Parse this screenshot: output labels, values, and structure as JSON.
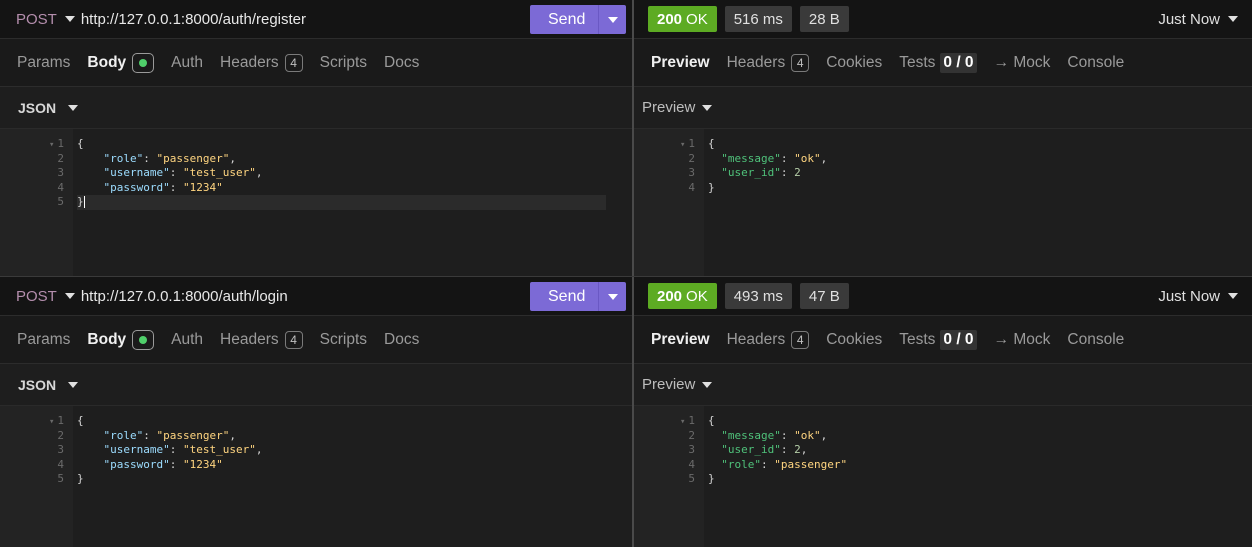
{
  "requests": [
    {
      "method": "POST",
      "url": "http://127.0.0.1:8000/auth/register",
      "send_label": "Send",
      "request_tabs": [
        {
          "label": "Params"
        },
        {
          "label": "Body"
        },
        {
          "label": "Auth"
        },
        {
          "label": "Headers",
          "badge": "4"
        },
        {
          "label": "Scripts"
        },
        {
          "label": "Docs"
        }
      ],
      "body_type": "JSON",
      "body_line_numbers": [
        "1",
        "2",
        "3",
        "4",
        "5"
      ],
      "body_lines": {
        "open": "{",
        "role_key": "\"role\"",
        "role_val": "\"passenger\"",
        "username_key": "\"username\"",
        "username_val": "\"test_user\"",
        "password_key": "\"password\"",
        "password_val": "\"1234\"",
        "close": "}"
      },
      "response": {
        "status_code": "200",
        "status_text": "OK",
        "time": "516 ms",
        "size": "28 B",
        "timestamp": "Just Now",
        "tabs": [
          {
            "label": "Preview"
          },
          {
            "label": "Headers",
            "badge": "4"
          },
          {
            "label": "Cookies"
          },
          {
            "label": "Tests",
            "score": "0 / 0"
          },
          {
            "label": "→ Mock"
          },
          {
            "label": "Console"
          }
        ],
        "preview_label": "Preview",
        "line_numbers": [
          "1",
          "2",
          "3",
          "4"
        ],
        "lines": {
          "open": "{",
          "message_key": "\"message\"",
          "message_val": "\"ok\"",
          "user_id_key": "\"user_id\"",
          "user_id_val": "2",
          "close": "}"
        }
      }
    },
    {
      "method": "POST",
      "url": "http://127.0.0.1:8000/auth/login",
      "send_label": "Send",
      "request_tabs": [
        {
          "label": "Params"
        },
        {
          "label": "Body"
        },
        {
          "label": "Auth"
        },
        {
          "label": "Headers",
          "badge": "4"
        },
        {
          "label": "Scripts"
        },
        {
          "label": "Docs"
        }
      ],
      "body_type": "JSON",
      "body_line_numbers": [
        "1",
        "2",
        "3",
        "4",
        "5"
      ],
      "body_lines": {
        "open": "{",
        "role_key": "\"role\"",
        "role_val": "\"passenger\"",
        "username_key": "\"username\"",
        "username_val": "\"test_user\"",
        "password_key": "\"password\"",
        "password_val": "\"1234\"",
        "close": "}"
      },
      "response": {
        "status_code": "200",
        "status_text": "OK",
        "time": "493 ms",
        "size": "47 B",
        "timestamp": "Just Now",
        "tabs": [
          {
            "label": "Preview"
          },
          {
            "label": "Headers",
            "badge": "4"
          },
          {
            "label": "Cookies"
          },
          {
            "label": "Tests",
            "score": "0 / 0"
          },
          {
            "label": "→ Mock"
          },
          {
            "label": "Console"
          }
        ],
        "preview_label": "Preview",
        "line_numbers": [
          "1",
          "2",
          "3",
          "4",
          "5"
        ],
        "lines": {
          "open": "{",
          "message_key": "\"message\"",
          "message_val": "\"ok\"",
          "user_id_key": "\"user_id\"",
          "user_id_val": "2",
          "role_key": "\"role\"",
          "role_val": "\"passenger\"",
          "close": "}"
        }
      }
    }
  ],
  "colors": {
    "send_button": "#7c6ad6",
    "status_ok": "#5dab23",
    "method": "#b48ead",
    "json_key": "#9cdcfe",
    "json_string": "#ffd580",
    "body_active_dot": "#4fcf6a"
  }
}
